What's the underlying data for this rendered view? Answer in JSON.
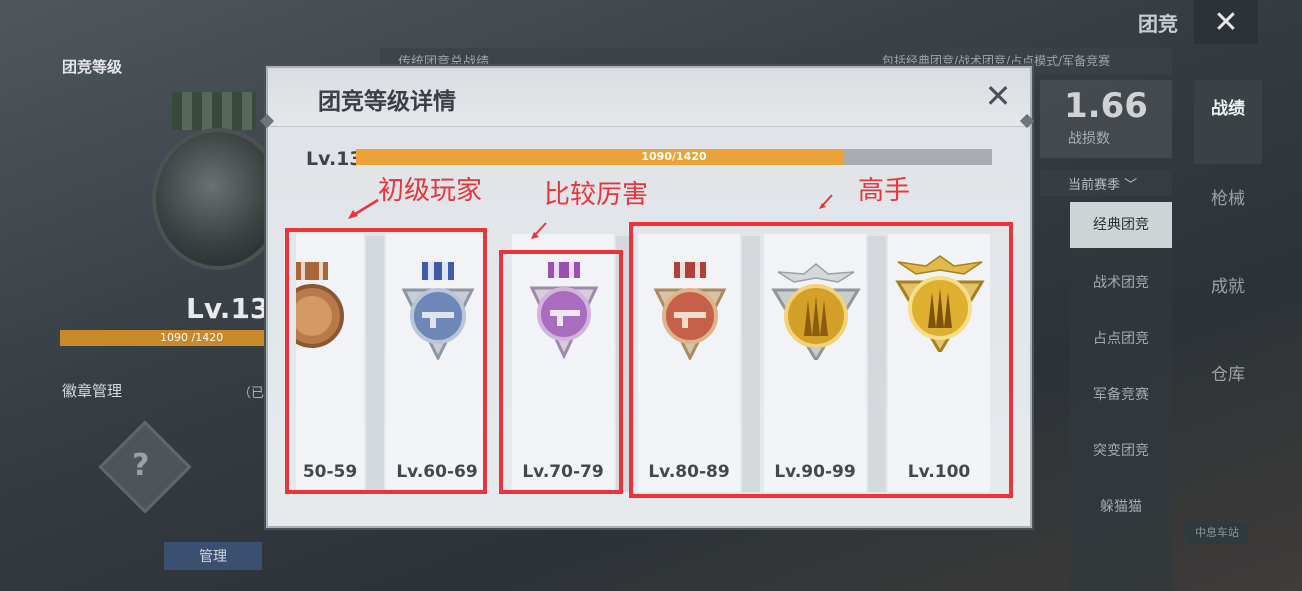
{
  "background": {
    "top_title": "团竞",
    "left_label": "团竞等级",
    "level": "Lv.13",
    "progress_text": "1090 /1420",
    "badge_manage": "徽章管理",
    "badge_note": "（已",
    "manage_button": "管理",
    "header_left": "传统团竞总战绩",
    "header_right": "包括经典团竞/战术团竞/占点模式/军备竞赛",
    "stat_value": "1.66",
    "stat_label": "战损数",
    "season": "当前赛季",
    "modes": [
      "经典团竞",
      "战术团竞",
      "占点团竞",
      "军备竞赛",
      "突变团竞",
      "躲猫猫"
    ],
    "side_tabs": [
      "战绩",
      "枪械",
      "成就",
      "仓库"
    ],
    "sign": "中息车站"
  },
  "modal": {
    "title": "团竞等级详情",
    "level_label": "Lv.13",
    "progress_text": "1090/1420",
    "progress_fraction": 0.7676,
    "cards": [
      {
        "label": "50-59",
        "medal": "bronze-medal-icon"
      },
      {
        "label": "Lv.60-69",
        "medal": "silver-medal-icon"
      },
      {
        "label": "Lv.70-79",
        "medal": "purple-medal-icon"
      },
      {
        "label": "Lv.80-89",
        "medal": "red-bronze-medal-icon"
      },
      {
        "label": "Lv.90-99",
        "medal": "gold-winged-medal-icon"
      },
      {
        "label": "Lv.100",
        "medal": "gold-winged-medal-top-icon"
      }
    ]
  },
  "annotations": {
    "beginner": "初级玩家",
    "intermediate": "比较厉害",
    "expert": "高手",
    "color": "#e8343a"
  }
}
